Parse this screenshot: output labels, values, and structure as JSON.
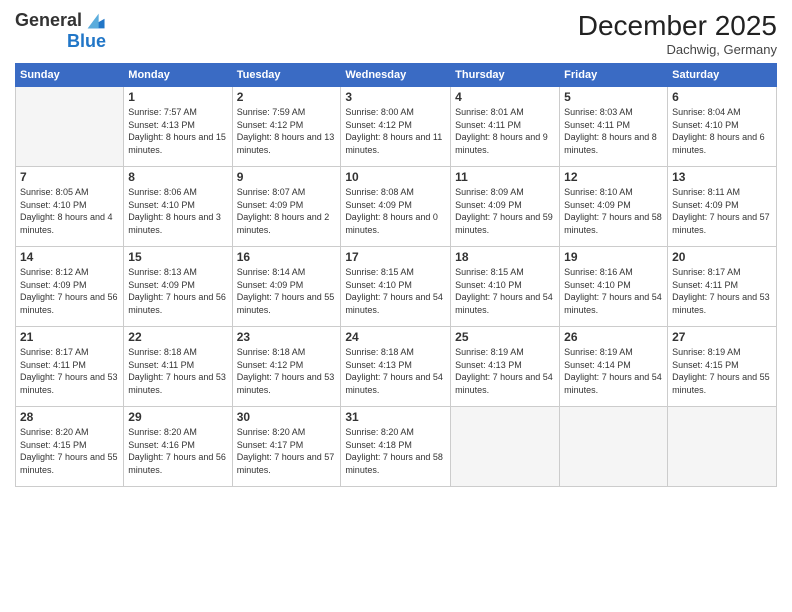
{
  "logo": {
    "general": "General",
    "blue": "Blue"
  },
  "header": {
    "month": "December 2025",
    "location": "Dachwig, Germany"
  },
  "weekdays": [
    "Sunday",
    "Monday",
    "Tuesday",
    "Wednesday",
    "Thursday",
    "Friday",
    "Saturday"
  ],
  "weeks": [
    [
      {
        "day": "",
        "empty": true
      },
      {
        "day": "1",
        "sunrise": "Sunrise: 7:57 AM",
        "sunset": "Sunset: 4:13 PM",
        "daylight": "Daylight: 8 hours and 15 minutes."
      },
      {
        "day": "2",
        "sunrise": "Sunrise: 7:59 AM",
        "sunset": "Sunset: 4:12 PM",
        "daylight": "Daylight: 8 hours and 13 minutes."
      },
      {
        "day": "3",
        "sunrise": "Sunrise: 8:00 AM",
        "sunset": "Sunset: 4:12 PM",
        "daylight": "Daylight: 8 hours and 11 minutes."
      },
      {
        "day": "4",
        "sunrise": "Sunrise: 8:01 AM",
        "sunset": "Sunset: 4:11 PM",
        "daylight": "Daylight: 8 hours and 9 minutes."
      },
      {
        "day": "5",
        "sunrise": "Sunrise: 8:03 AM",
        "sunset": "Sunset: 4:11 PM",
        "daylight": "Daylight: 8 hours and 8 minutes."
      },
      {
        "day": "6",
        "sunrise": "Sunrise: 8:04 AM",
        "sunset": "Sunset: 4:10 PM",
        "daylight": "Daylight: 8 hours and 6 minutes."
      }
    ],
    [
      {
        "day": "7",
        "sunrise": "Sunrise: 8:05 AM",
        "sunset": "Sunset: 4:10 PM",
        "daylight": "Daylight: 8 hours and 4 minutes."
      },
      {
        "day": "8",
        "sunrise": "Sunrise: 8:06 AM",
        "sunset": "Sunset: 4:10 PM",
        "daylight": "Daylight: 8 hours and 3 minutes."
      },
      {
        "day": "9",
        "sunrise": "Sunrise: 8:07 AM",
        "sunset": "Sunset: 4:09 PM",
        "daylight": "Daylight: 8 hours and 2 minutes."
      },
      {
        "day": "10",
        "sunrise": "Sunrise: 8:08 AM",
        "sunset": "Sunset: 4:09 PM",
        "daylight": "Daylight: 8 hours and 0 minutes."
      },
      {
        "day": "11",
        "sunrise": "Sunrise: 8:09 AM",
        "sunset": "Sunset: 4:09 PM",
        "daylight": "Daylight: 7 hours and 59 minutes."
      },
      {
        "day": "12",
        "sunrise": "Sunrise: 8:10 AM",
        "sunset": "Sunset: 4:09 PM",
        "daylight": "Daylight: 7 hours and 58 minutes."
      },
      {
        "day": "13",
        "sunrise": "Sunrise: 8:11 AM",
        "sunset": "Sunset: 4:09 PM",
        "daylight": "Daylight: 7 hours and 57 minutes."
      }
    ],
    [
      {
        "day": "14",
        "sunrise": "Sunrise: 8:12 AM",
        "sunset": "Sunset: 4:09 PM",
        "daylight": "Daylight: 7 hours and 56 minutes."
      },
      {
        "day": "15",
        "sunrise": "Sunrise: 8:13 AM",
        "sunset": "Sunset: 4:09 PM",
        "daylight": "Daylight: 7 hours and 56 minutes."
      },
      {
        "day": "16",
        "sunrise": "Sunrise: 8:14 AM",
        "sunset": "Sunset: 4:09 PM",
        "daylight": "Daylight: 7 hours and 55 minutes."
      },
      {
        "day": "17",
        "sunrise": "Sunrise: 8:15 AM",
        "sunset": "Sunset: 4:10 PM",
        "daylight": "Daylight: 7 hours and 54 minutes."
      },
      {
        "day": "18",
        "sunrise": "Sunrise: 8:15 AM",
        "sunset": "Sunset: 4:10 PM",
        "daylight": "Daylight: 7 hours and 54 minutes."
      },
      {
        "day": "19",
        "sunrise": "Sunrise: 8:16 AM",
        "sunset": "Sunset: 4:10 PM",
        "daylight": "Daylight: 7 hours and 54 minutes."
      },
      {
        "day": "20",
        "sunrise": "Sunrise: 8:17 AM",
        "sunset": "Sunset: 4:11 PM",
        "daylight": "Daylight: 7 hours and 53 minutes."
      }
    ],
    [
      {
        "day": "21",
        "sunrise": "Sunrise: 8:17 AM",
        "sunset": "Sunset: 4:11 PM",
        "daylight": "Daylight: 7 hours and 53 minutes."
      },
      {
        "day": "22",
        "sunrise": "Sunrise: 8:18 AM",
        "sunset": "Sunset: 4:11 PM",
        "daylight": "Daylight: 7 hours and 53 minutes."
      },
      {
        "day": "23",
        "sunrise": "Sunrise: 8:18 AM",
        "sunset": "Sunset: 4:12 PM",
        "daylight": "Daylight: 7 hours and 53 minutes."
      },
      {
        "day": "24",
        "sunrise": "Sunrise: 8:18 AM",
        "sunset": "Sunset: 4:13 PM",
        "daylight": "Daylight: 7 hours and 54 minutes."
      },
      {
        "day": "25",
        "sunrise": "Sunrise: 8:19 AM",
        "sunset": "Sunset: 4:13 PM",
        "daylight": "Daylight: 7 hours and 54 minutes."
      },
      {
        "day": "26",
        "sunrise": "Sunrise: 8:19 AM",
        "sunset": "Sunset: 4:14 PM",
        "daylight": "Daylight: 7 hours and 54 minutes."
      },
      {
        "day": "27",
        "sunrise": "Sunrise: 8:19 AM",
        "sunset": "Sunset: 4:15 PM",
        "daylight": "Daylight: 7 hours and 55 minutes."
      }
    ],
    [
      {
        "day": "28",
        "sunrise": "Sunrise: 8:20 AM",
        "sunset": "Sunset: 4:15 PM",
        "daylight": "Daylight: 7 hours and 55 minutes."
      },
      {
        "day": "29",
        "sunrise": "Sunrise: 8:20 AM",
        "sunset": "Sunset: 4:16 PM",
        "daylight": "Daylight: 7 hours and 56 minutes."
      },
      {
        "day": "30",
        "sunrise": "Sunrise: 8:20 AM",
        "sunset": "Sunset: 4:17 PM",
        "daylight": "Daylight: 7 hours and 57 minutes."
      },
      {
        "day": "31",
        "sunrise": "Sunrise: 8:20 AM",
        "sunset": "Sunset: 4:18 PM",
        "daylight": "Daylight: 7 hours and 58 minutes."
      },
      {
        "day": "",
        "empty": true
      },
      {
        "day": "",
        "empty": true
      },
      {
        "day": "",
        "empty": true
      }
    ]
  ]
}
